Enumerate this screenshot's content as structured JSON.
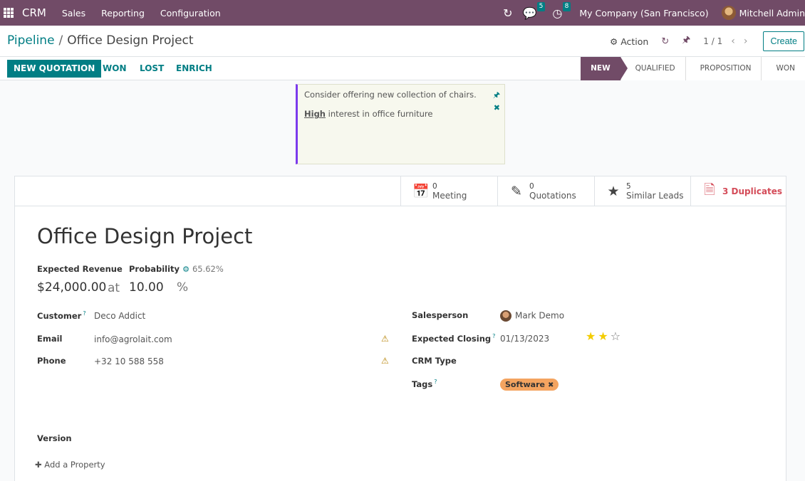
{
  "navbar": {
    "brand": "CRM",
    "menu": [
      "Sales",
      "Reporting",
      "Configuration"
    ],
    "activity_icon": "refresh-icon",
    "messages_count": "5",
    "activities_count": "8",
    "company": "My Company (San Francisco)",
    "user": "Mitchell Admin"
  },
  "control_panel": {
    "breadcrumb_parent": "Pipeline",
    "breadcrumb_sep": "/",
    "breadcrumb_current": "Office Design Project",
    "action_label": "Action",
    "pager": "1 / 1",
    "create_label": "Create"
  },
  "statusbar": {
    "new_quotation": "NEW QUOTATION",
    "won": "WON",
    "lost": "LOST",
    "enrich": "ENRICH",
    "stages": [
      "NEW",
      "QUALIFIED",
      "PROPOSITION",
      "WON"
    ],
    "active_stage": "NEW"
  },
  "note": {
    "line1": "Consider offering new collection of chairs.",
    "line2_link": "High",
    "line2_rest": " interest in office furniture"
  },
  "smart_buttons": {
    "meeting_count": "0",
    "meeting_label": "Meeting",
    "quotations_count": "0",
    "quotations_label": "Quotations",
    "similar_count": "5",
    "similar_label": "Similar Leads",
    "duplicates_label": "3 Duplicates"
  },
  "form": {
    "title": "Office Design Project",
    "expected_revenue_label": "Expected Revenue",
    "probability_label": "Probability",
    "probability_value": "65.62%",
    "revenue_value": "$24,000.00",
    "at_word": "at",
    "probability_input": "10.00",
    "percent_sign": "%",
    "customer_label": "Customer",
    "customer_value": "Deco Addict",
    "email_label": "Email",
    "email_value": "info@agrolait.com",
    "phone_label": "Phone",
    "phone_value": "+32 10 588 558",
    "salesperson_label": "Salesperson",
    "salesperson_value": "Mark Demo",
    "expected_closing_label": "Expected Closing",
    "expected_closing_value": "01/13/2023",
    "priority_stars": 2,
    "crm_type_label": "CRM Type",
    "tags_label": "Tags",
    "tag_value": "Software",
    "version_label": "Version",
    "add_property": "Add a Property",
    "help_mark": "?"
  },
  "colors": {
    "brand": "#714b67",
    "accent": "#017e84",
    "danger": "#d44c59",
    "tag": "#f4a460",
    "star": "#f3cc00"
  }
}
